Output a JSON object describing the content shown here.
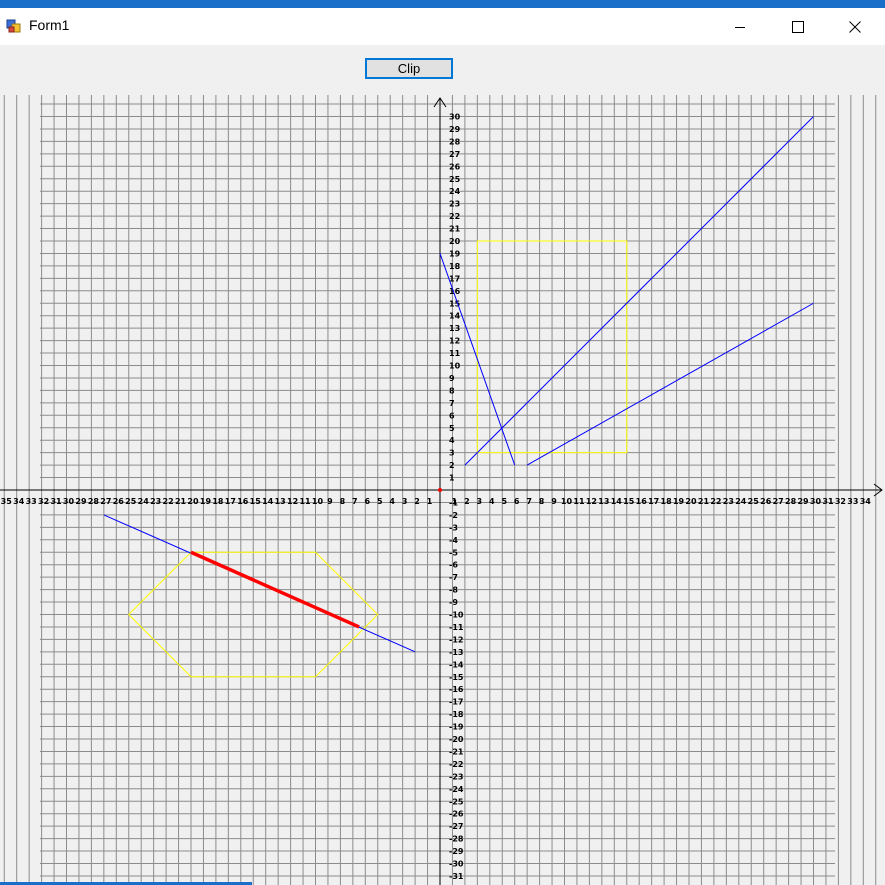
{
  "window": {
    "title": "Form1",
    "accent": "#1a6fc9"
  },
  "toolbar": {
    "clip_label": "Clip"
  },
  "plot": {
    "grid": true,
    "x_range": [
      -35,
      34
    ],
    "y_range": [
      -31,
      30
    ],
    "colors": {
      "grid": "#8c8c8c",
      "axis": "#000000",
      "line": "#0000ff",
      "clip_window": "#ffff00",
      "clipped_segment": "#ff0000",
      "origin": "#ff0000"
    },
    "lines": [
      {
        "x1": 2,
        "y1": 2,
        "x2": 30,
        "y2": 30
      },
      {
        "x1": 7,
        "y1": 2,
        "x2": 30,
        "y2": 15
      },
      {
        "x1": 0,
        "y1": 19,
        "x2": 6,
        "y2": 2
      },
      {
        "x1": -27,
        "y1": -2,
        "x2": -2,
        "y2": -13
      }
    ],
    "clip_windows": [
      {
        "name": "rectangle",
        "points": [
          [
            3,
            20
          ],
          [
            15,
            20
          ],
          [
            15,
            3
          ],
          [
            3,
            3
          ]
        ]
      },
      {
        "name": "hexagon",
        "points": [
          [
            -20,
            -5
          ],
          [
            -10,
            -5
          ],
          [
            -5,
            -10
          ],
          [
            -10,
            -15
          ],
          [
            -20,
            -15
          ],
          [
            -25,
            -10
          ]
        ]
      }
    ],
    "clipped_segments": [
      {
        "x1": -20,
        "y1": -5,
        "x2": -6.5,
        "y2": -11
      }
    ]
  }
}
